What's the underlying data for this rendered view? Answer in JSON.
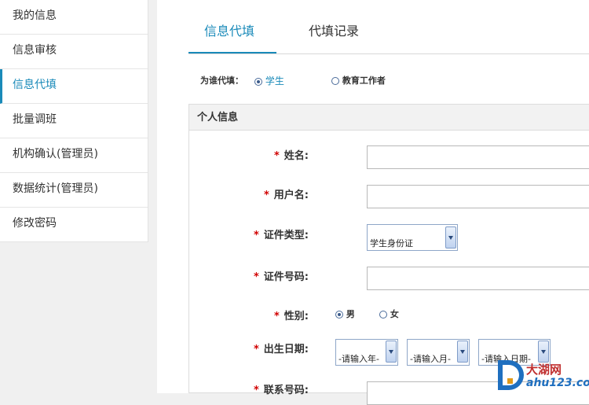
{
  "sidebar": {
    "items": [
      {
        "label": "我的信息"
      },
      {
        "label": "信息审核"
      },
      {
        "label": "信息代填"
      },
      {
        "label": "批量调班"
      },
      {
        "label": "机构确认(管理员)"
      },
      {
        "label": "数据统计(管理员)"
      },
      {
        "label": "修改密码"
      }
    ],
    "active_index": 2
  },
  "tabs": [
    {
      "label": "信息代填"
    },
    {
      "label": "代填记录"
    }
  ],
  "who_fill": {
    "label": "为谁代填：",
    "options": [
      {
        "label": "学生",
        "checked": true
      },
      {
        "label": "教育工作者",
        "checked": false
      }
    ]
  },
  "section": {
    "title": "个人信息",
    "fields": {
      "name": "姓名:",
      "username": "用户名:",
      "id_type": "证件类型:",
      "id_number": "证件号码:",
      "gender": "性别:",
      "birth": "出生日期:",
      "phone": "联系号码:"
    },
    "id_type_value": "学生身份证",
    "gender_options": [
      {
        "label": "男",
        "checked": true
      },
      {
        "label": "女",
        "checked": false
      }
    ],
    "birth_selects": {
      "year": "-请输入年-",
      "month": "-请输入月-",
      "day": "-请输入日期-"
    }
  },
  "watermark": {
    "brand": "大湖网",
    "url": "ahu123.com",
    "letter": "D"
  },
  "colors": {
    "accent": "#1a8ab9",
    "required": "#d10000"
  }
}
